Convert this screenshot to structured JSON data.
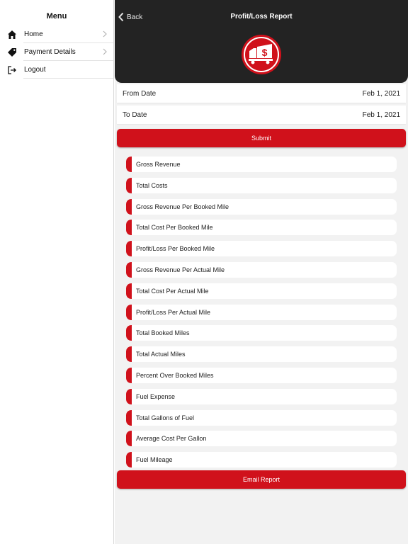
{
  "sidebar": {
    "title": "Menu",
    "items": [
      {
        "label": "Home",
        "icon": "home-icon"
      },
      {
        "label": "Payment Details",
        "icon": "tag-icon"
      },
      {
        "label": "Logout",
        "icon": "logout-icon"
      }
    ]
  },
  "header": {
    "back_label": "Back",
    "title": "Profit/Loss Report",
    "logo": "truck-dollar-logo"
  },
  "form": {
    "from_date_label": "From Date",
    "from_date_value": "Feb 1, 2021",
    "to_date_label": "To Date",
    "to_date_value": "Feb 1, 2021",
    "submit_label": "Submit"
  },
  "report_items": [
    "Gross Revenue",
    "Total Costs",
    "Gross Revenue Per Booked Mile",
    "Total Cost Per Booked Mile",
    "Profit/Loss Per Booked Mile",
    "Gross Revenue Per Actual Mile",
    " Total Cost Per Actual Mile",
    "Profit/Loss Per Actual Mile",
    "Total Booked Miles",
    "Total Actual Miles",
    "Percent Over Booked Miles",
    " Fuel Expense",
    "Total Gallons of Fuel",
    " Average Cost Per Gallon",
    " Fuel Mileage"
  ],
  "email_label": "Email Report",
  "colors": {
    "accent": "#d0111b",
    "header_bg": "#232323",
    "page_bg": "#f2f2f2"
  }
}
